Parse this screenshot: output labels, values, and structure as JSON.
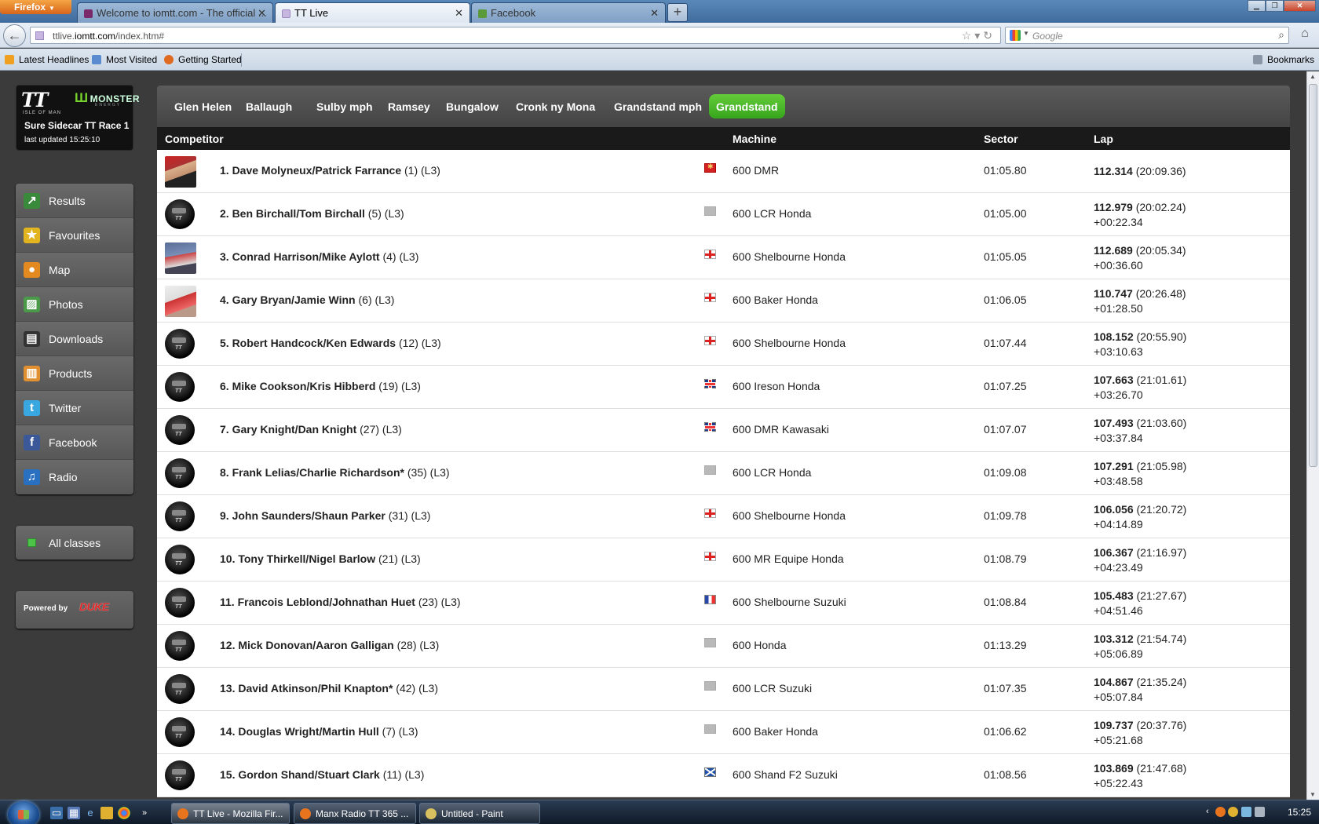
{
  "browser": {
    "app_button": "Firefox",
    "tabs": [
      {
        "label": "Welcome to iomtt.com - The official ...",
        "active": false
      },
      {
        "label": "TT Live",
        "active": true
      },
      {
        "label": "Facebook",
        "active": false
      }
    ],
    "url_prefix": "ttlive.",
    "url_domain": "iomtt.com",
    "url_path": "/index.htm#",
    "search_placeholder": "Google",
    "bookmarks_left": [
      "Latest Headlines",
      "Most Visited",
      "Getting Started"
    ],
    "bookmarks_right": "Bookmarks"
  },
  "sidebar": {
    "race_title": "Sure Sidecar TT Race 1",
    "last_updated": "last updated 15:25:10",
    "logo_text": {
      "tt": "TT",
      "isle": "ISLE OF MAN",
      "monster": "MONSTER",
      "energy": "ENERGY"
    },
    "menu": [
      {
        "label": "Results",
        "icon": "chart-icon",
        "color": "#3a8a3c"
      },
      {
        "label": "Favourites",
        "icon": "star-icon",
        "color": "#e2b520"
      },
      {
        "label": "Map",
        "icon": "pin-icon",
        "color": "#e28a20"
      },
      {
        "label": "Photos",
        "icon": "photo-icon",
        "color": "#4a9a4a"
      },
      {
        "label": "Downloads",
        "icon": "clapperboard-icon",
        "color": "#333333"
      },
      {
        "label": "Products",
        "icon": "basket-icon",
        "color": "#e09030"
      },
      {
        "label": "Twitter",
        "icon": "twitter-icon",
        "color": "#3aa8e0"
      },
      {
        "label": "Facebook",
        "icon": "facebook-icon",
        "color": "#3b5998"
      },
      {
        "label": "Radio",
        "icon": "music-note-icon",
        "color": "#2a70c0"
      }
    ],
    "all_classes": "All classes",
    "powered_by": "Powered by",
    "powered_brand": "DUKE"
  },
  "locations": [
    "Glen Helen",
    "Ballaugh",
    "Sulby mph",
    "Ramsey",
    "Bungalow",
    "Cronk ny Mona",
    "Grandstand mph",
    "Grandstand"
  ],
  "active_location": "Grandstand",
  "accent_color": "#4cb82a",
  "columns": {
    "competitor": "Competitor",
    "machine": "Machine",
    "sector": "Sector",
    "lap": "Lap"
  },
  "rows": [
    {
      "name": "1. Dave Molyneux/Patrick Farrance",
      "extra": "(1) (L3)",
      "pic": "photo1",
      "flag": "iom",
      "machine": "600 DMR",
      "sector": "01:05.80",
      "lap_speed": "112.314",
      "lap_time": "(20:09.36)",
      "gap": ""
    },
    {
      "name": "2. Ben Birchall/Tom Birchall",
      "extra": "(5) (L3)",
      "pic": "helmet",
      "flag": "grey",
      "machine": "600 LCR Honda",
      "sector": "01:05.00",
      "lap_speed": "112.979",
      "lap_time": "(20:02.24)",
      "gap": "+00:22.34"
    },
    {
      "name": "3. Conrad Harrison/Mike Aylott",
      "extra": "(4) (L3)",
      "pic": "photo3",
      "flag": "eng",
      "machine": "600 Shelbourne Honda",
      "sector": "01:05.05",
      "lap_speed": "112.689",
      "lap_time": "(20:05.34)",
      "gap": "+00:36.60"
    },
    {
      "name": "4. Gary Bryan/Jamie Winn",
      "extra": "(6) (L3)",
      "pic": "photo4",
      "flag": "eng",
      "machine": "600 Baker Honda",
      "sector": "01:06.05",
      "lap_speed": "110.747",
      "lap_time": "(20:26.48)",
      "gap": "+01:28.50"
    },
    {
      "name": "5. Robert Handcock/Ken Edwards",
      "extra": "(12) (L3)",
      "pic": "helmet",
      "flag": "eng",
      "machine": "600 Shelbourne Honda",
      "sector": "01:07.44",
      "lap_speed": "108.152",
      "lap_time": "(20:55.90)",
      "gap": "+03:10.63"
    },
    {
      "name": "6. Mike Cookson/Kris Hibberd",
      "extra": "(19) (L3)",
      "pic": "helmet",
      "flag": "gb",
      "machine": "600 Ireson Honda",
      "sector": "01:07.25",
      "lap_speed": "107.663",
      "lap_time": "(21:01.61)",
      "gap": "+03:26.70"
    },
    {
      "name": "7. Gary Knight/Dan Knight",
      "extra": "(27) (L3)",
      "pic": "helmet",
      "flag": "gb",
      "machine": "600 DMR Kawasaki",
      "sector": "01:07.07",
      "lap_speed": "107.493",
      "lap_time": "(21:03.60)",
      "gap": "+03:37.84"
    },
    {
      "name": "8. Frank Lelias/Charlie Richardson*",
      "extra": "(35) (L3)",
      "pic": "helmet",
      "flag": "grey",
      "machine": "600 LCR Honda",
      "sector": "01:09.08",
      "lap_speed": "107.291",
      "lap_time": "(21:05.98)",
      "gap": "+03:48.58"
    },
    {
      "name": "9. John Saunders/Shaun Parker",
      "extra": "(31) (L3)",
      "pic": "helmet",
      "flag": "eng",
      "machine": "600 Shelbourne Honda",
      "sector": "01:09.78",
      "lap_speed": "106.056",
      "lap_time": "(21:20.72)",
      "gap": "+04:14.89"
    },
    {
      "name": "10. Tony Thirkell/Nigel Barlow",
      "extra": "(21) (L3)",
      "pic": "helmet",
      "flag": "eng",
      "machine": "600 MR Equipe Honda",
      "sector": "01:08.79",
      "lap_speed": "106.367",
      "lap_time": "(21:16.97)",
      "gap": "+04:23.49"
    },
    {
      "name": "11. Francois Leblond/Johnathan Huet",
      "extra": "(23) (L3)",
      "pic": "helmet",
      "flag": "fr",
      "machine": "600 Shelbourne Suzuki",
      "sector": "01:08.84",
      "lap_speed": "105.483",
      "lap_time": "(21:27.67)",
      "gap": "+04:51.46"
    },
    {
      "name": "12. Mick Donovan/Aaron Galligan",
      "extra": "(28) (L3)",
      "pic": "helmet",
      "flag": "grey",
      "machine": "600 Honda",
      "sector": "01:13.29",
      "lap_speed": "103.312",
      "lap_time": "(21:54.74)",
      "gap": "+05:06.89"
    },
    {
      "name": "13. David Atkinson/Phil Knapton*",
      "extra": "(42) (L3)",
      "pic": "helmet",
      "flag": "grey",
      "machine": "600 LCR Suzuki",
      "sector": "01:07.35",
      "lap_speed": "104.867",
      "lap_time": "(21:35.24)",
      "gap": "+05:07.84"
    },
    {
      "name": "14. Douglas Wright/Martin Hull",
      "extra": "(7) (L3)",
      "pic": "helmet",
      "flag": "grey",
      "machine": "600 Baker Honda",
      "sector": "01:06.62",
      "lap_speed": "109.737",
      "lap_time": "(20:37.76)",
      "gap": "+05:21.68"
    },
    {
      "name": "15. Gordon Shand/Stuart Clark",
      "extra": "(11) (L3)",
      "pic": "helmet",
      "flag": "sco",
      "machine": "600 Shand F2 Suzuki",
      "sector": "01:08.56",
      "lap_speed": "103.869",
      "lap_time": "(21:47.68)",
      "gap": "+05:22.43"
    }
  ],
  "taskbar": {
    "windows": [
      {
        "label": "TT Live - Mozilla Fir...",
        "active": true,
        "color": "#e8741e"
      },
      {
        "label": "Manx Radio TT 365 ...",
        "active": false,
        "color": "#e8741e"
      },
      {
        "label": "Untitled - Paint",
        "active": false,
        "color": "#d8c060"
      }
    ],
    "clock": "15:25"
  }
}
